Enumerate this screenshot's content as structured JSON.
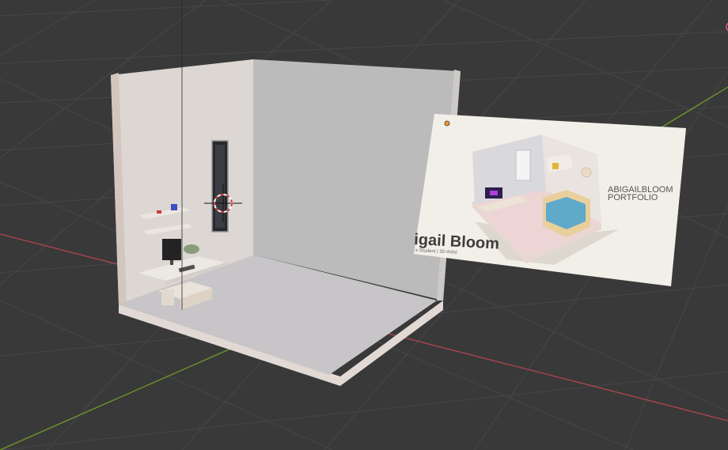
{
  "app": {
    "name": "Blender 3D Viewport"
  },
  "viewport": {
    "background_color": "#393939",
    "grid_color": "#474747",
    "x_axis_color": "#b3454f",
    "y_axis_color": "#6e9a2c"
  },
  "reference_image": {
    "title_line1": "ABIGAILBLOOM",
    "title_line2": "PORTFOLIO",
    "name_text": "igail Bloom",
    "subtitle_text": "s Student | 3D Artist"
  },
  "scene_objects": [
    {
      "name": "room-walls",
      "icon": "room-mesh"
    },
    {
      "name": "window",
      "icon": "window-mesh"
    },
    {
      "name": "desk",
      "icon": "desk-mesh"
    },
    {
      "name": "monitor",
      "icon": "monitor-mesh"
    },
    {
      "name": "shelves",
      "icon": "shelf-mesh"
    },
    {
      "name": "3d-cursor",
      "icon": "cursor-crosshair"
    }
  ]
}
